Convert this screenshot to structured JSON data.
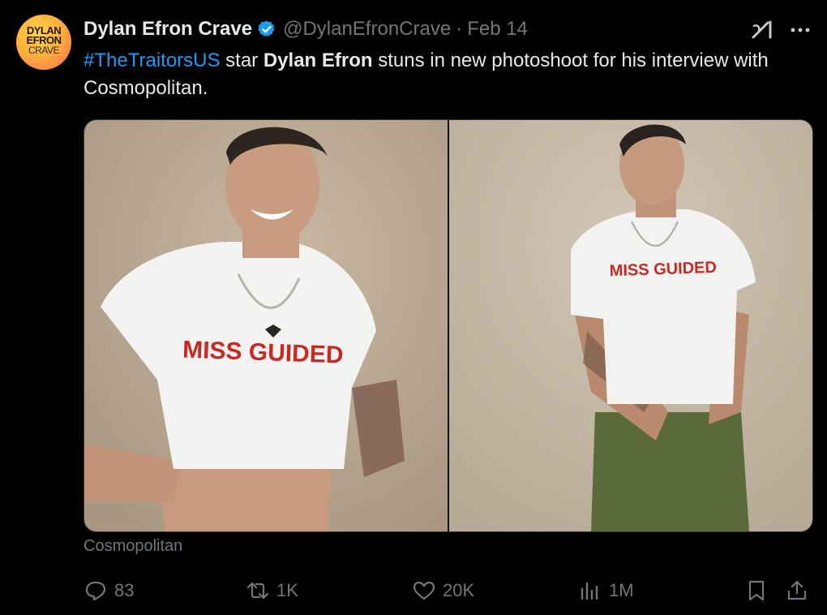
{
  "author": {
    "avatar_lines": [
      "DYLAN",
      "EFRON",
      "CRAVE"
    ],
    "display_name": "Dylan Efron Crave",
    "handle": "@DylanEfronCrave",
    "separator": "·",
    "date": "Feb 14",
    "verified": true
  },
  "tweet": {
    "hashtag": "#TheTraitorsUS",
    "text_1": " star ",
    "bold_name": "Dylan Efron",
    "text_2": " stuns in new photoshoot for his interview with Cosmopolitan."
  },
  "media": {
    "left": {
      "shirt_text": "MISS GUIDED"
    },
    "right": {
      "shirt_text": "MISS GUIDED"
    },
    "source": "Cosmopolitan"
  },
  "actions": {
    "replies": "83",
    "reposts": "1K",
    "likes": "20K",
    "views": "1M"
  },
  "icons": {
    "verified": "verified-badge-icon",
    "grok": "grok-icon",
    "more": "more-icon",
    "reply": "reply-icon",
    "repost": "repost-icon",
    "like": "like-icon",
    "views": "views-icon",
    "bookmark": "bookmark-icon",
    "share": "share-icon"
  },
  "colors": {
    "background": "#000000",
    "text": "#e7e9ea",
    "muted": "#71767b",
    "link": "#1d9bf0",
    "verified": "#1d9bf0"
  }
}
